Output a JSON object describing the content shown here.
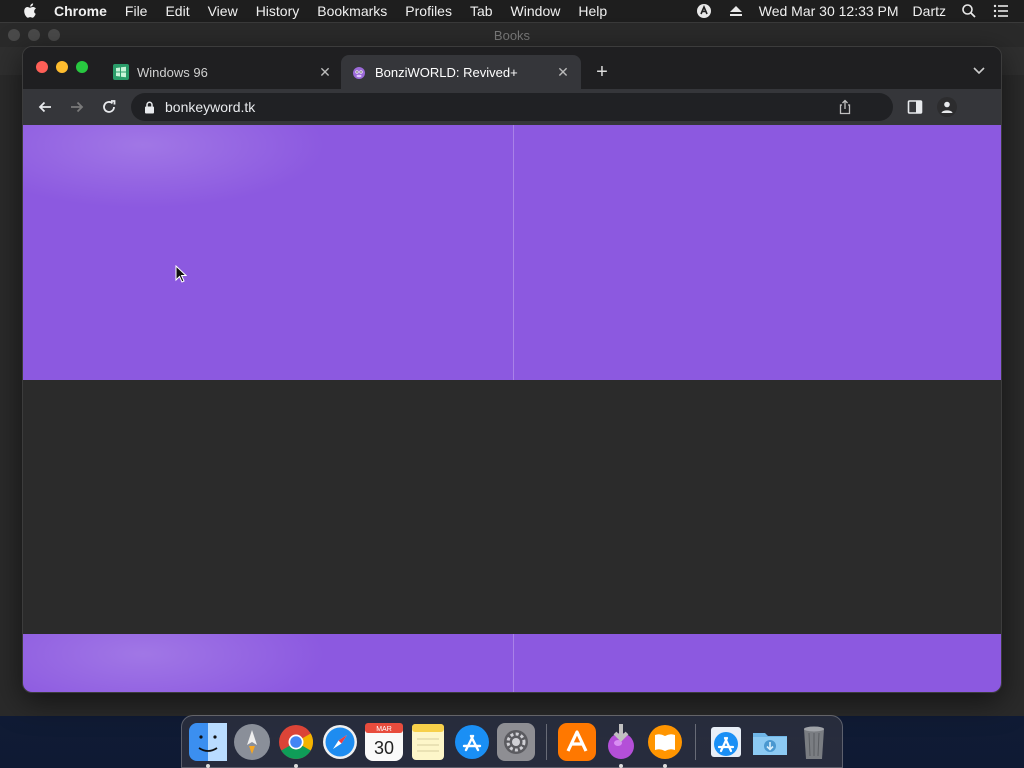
{
  "menubar": {
    "app_name": "Chrome",
    "items": [
      "File",
      "Edit",
      "View",
      "History",
      "Bookmarks",
      "Profiles",
      "Tab",
      "Window",
      "Help"
    ],
    "clock": "Wed Mar 30  12:33 PM",
    "user": "Dartz"
  },
  "background_window": {
    "title": "Books"
  },
  "browser": {
    "tabs": [
      {
        "title": "Windows 96",
        "favicon": "windows96-favicon",
        "active": false
      },
      {
        "title": "BonziWORLD: Revived+",
        "favicon": "bonziworld-favicon",
        "active": true
      }
    ],
    "url": "bonkeyword.tk"
  },
  "page": {
    "band_color": "#8c59e0",
    "middle_color": "#2b2b2b"
  },
  "dock": {
    "calendar_month": "MAR",
    "calendar_day": "30",
    "apps": [
      "finder",
      "launchpad",
      "chrome",
      "safari",
      "calendar",
      "notes",
      "app-store",
      "system-preferences",
      "avast",
      "installer",
      "books",
      "app-store-folder",
      "downloads-folder",
      "trash"
    ]
  }
}
